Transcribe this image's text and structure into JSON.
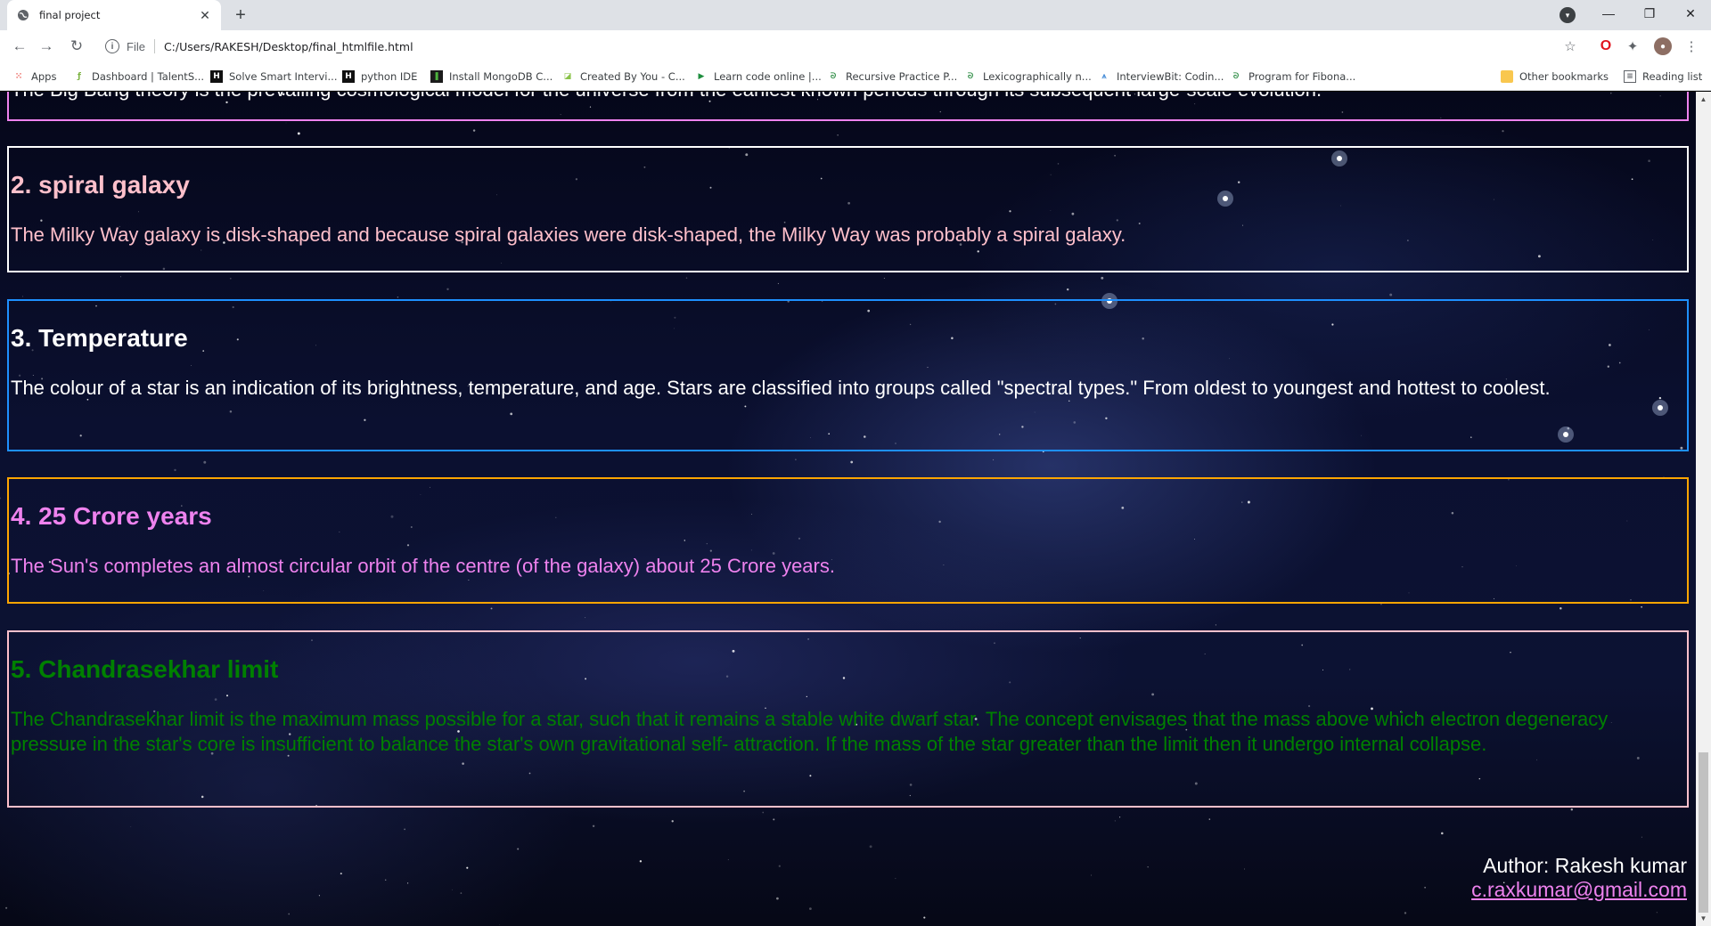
{
  "browser": {
    "tab_title": "final project",
    "address_scheme": "File",
    "url": "C:/Users/RAKESH/Desktop/final_htmlfile.html",
    "bookmarks": [
      {
        "label": "Apps",
        "icon": "apps-grid-icon"
      },
      {
        "label": "Dashboard | TalentS...",
        "icon": "talent-icon"
      },
      {
        "label": "Solve Smart Intervi...",
        "icon": "solve-icon"
      },
      {
        "label": "python IDE",
        "icon": "python-ide-icon"
      },
      {
        "label": "Install MongoDB C...",
        "icon": "mongodb-icon"
      },
      {
        "label": "Created By You - C...",
        "icon": "created-icon"
      },
      {
        "label": "Learn code online |...",
        "icon": "play-icon"
      },
      {
        "label": "Recursive Practice P...",
        "icon": "gfg-icon"
      },
      {
        "label": "Lexicographically n...",
        "icon": "gfg-icon"
      },
      {
        "label": "InterviewBit: Codin...",
        "icon": "interviewbit-icon"
      },
      {
        "label": "Program for Fibona...",
        "icon": "gfg-icon"
      }
    ],
    "other_bookmarks": "Other bookmarks",
    "reading_list": "Reading list"
  },
  "page": {
    "sections": [
      {
        "heading": "",
        "text": "The Big Bang theory is the prevailing cosmological model for the universe from the earliest known periods through its subsequent large-scale evolution.",
        "border_color": "#ee82ee",
        "text_color": "#ffffff"
      },
      {
        "heading": "2. spiral galaxy",
        "text": "The Milky Way galaxy is disk-shaped and because spiral galaxies were disk-shaped, the Milky Way was probably a spiral galaxy.",
        "border_color": "#ffffff",
        "text_color": "#ffc0cb"
      },
      {
        "heading": "3. Temperature",
        "text": "The colour of a star is an indication of its brightness, temperature, and age. Stars are classified into groups called \"spectral types.\" From oldest to youngest and hottest to coolest.",
        "border_color": "#1e90ff",
        "text_color": "#ffffff"
      },
      {
        "heading": "4. 25 Crore years",
        "text": "The Sun's completes an almost circular orbit of the centre (of the galaxy) about 25 Crore years.",
        "border_color": "#ffa500",
        "text_color": "#ee82ee"
      },
      {
        "heading": "5. Chandrasekhar limit",
        "text": "The Chandrasekhar limit is the maximum mass possible for a star, such that it remains a stable white dwarf star. The concept envisages that the mass above which electron degeneracy pressure in the star's core is insufficient to balance the star's own gravitational self- attraction. If the mass of the star greater than the limit then it undergo internal collapse.",
        "border_color": "#ffc0cb",
        "text_color": "#008000"
      }
    ],
    "footer": {
      "author": "Author: Rakesh kumar",
      "email": "c.raxkumar@gmail.com"
    }
  }
}
